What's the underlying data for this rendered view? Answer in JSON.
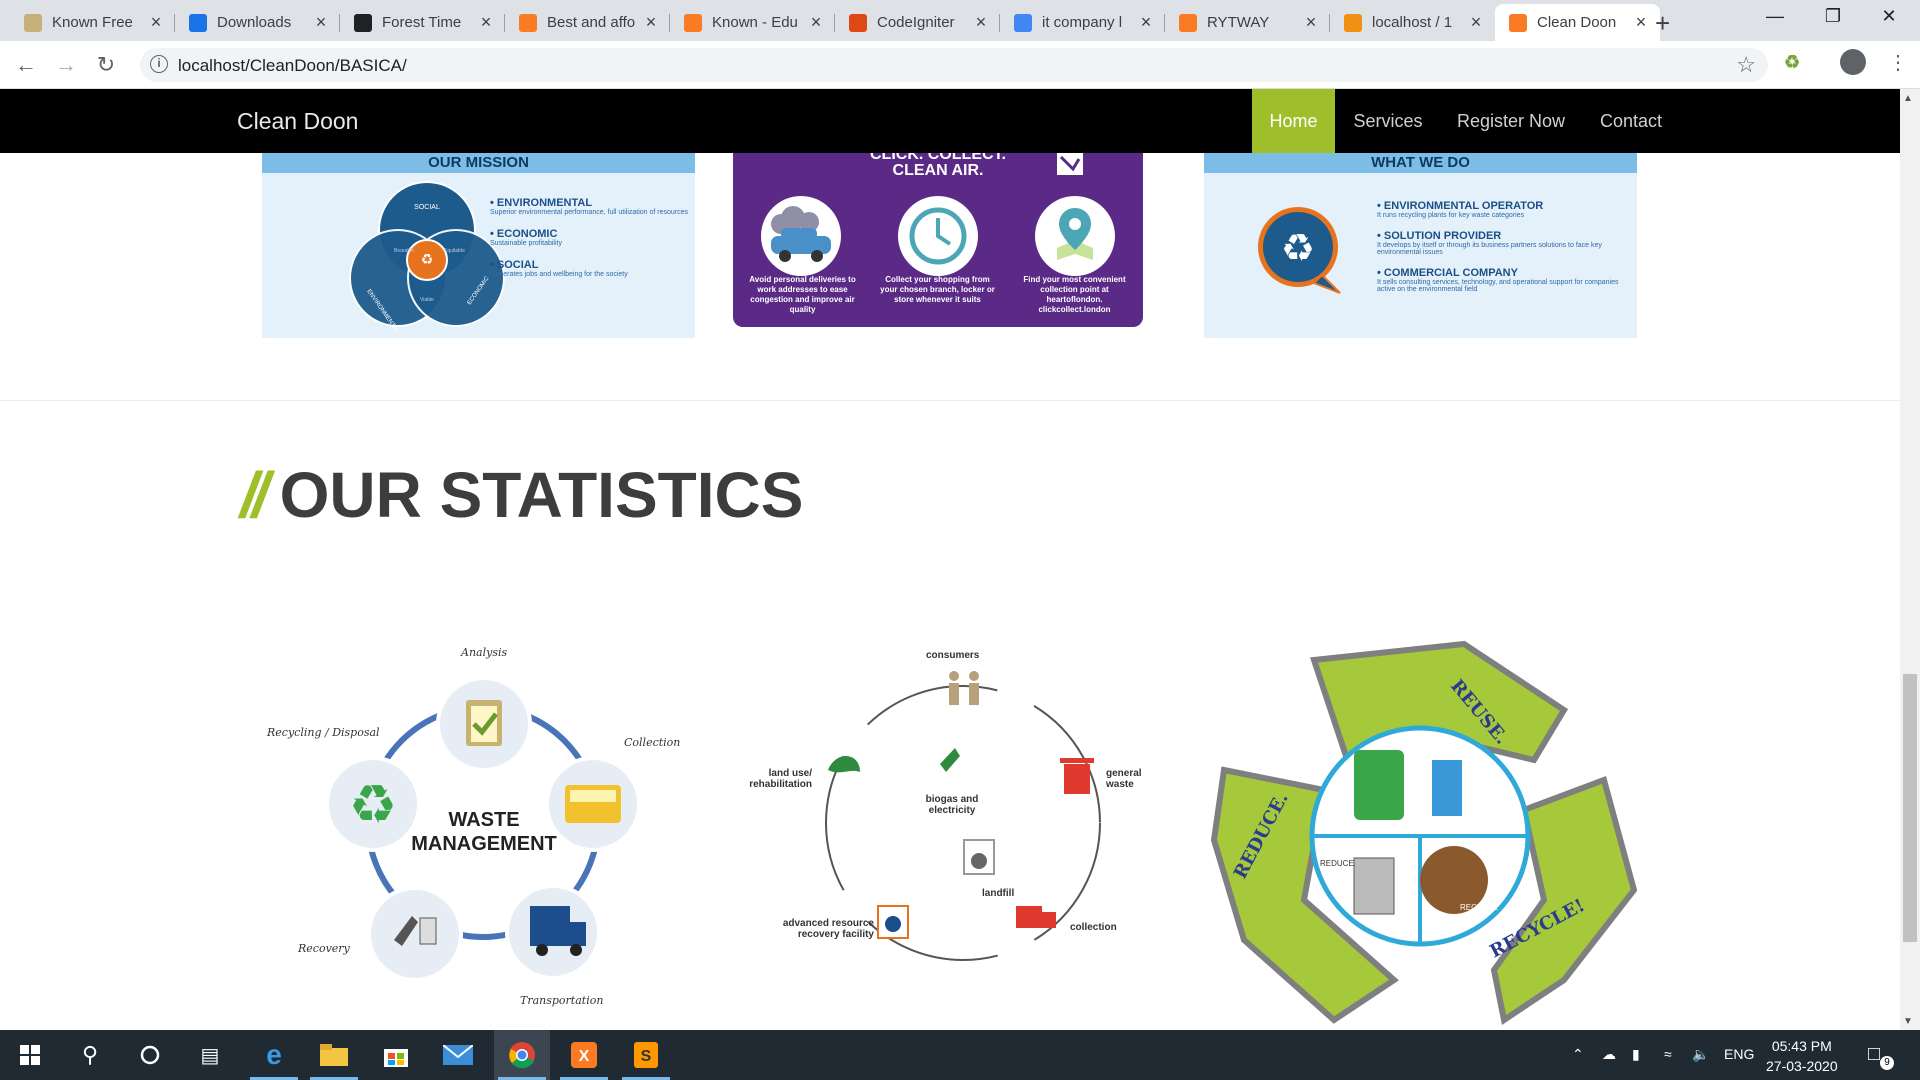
{
  "browser": {
    "tabs": [
      {
        "label": "Known Free",
        "favicon": "document-icon",
        "color": "#c6b07a"
      },
      {
        "label": "Downloads",
        "favicon": "download-icon",
        "color": "#1a73e8"
      },
      {
        "label": "Forest Time",
        "favicon": "edge-e-icon",
        "color": "#202124"
      },
      {
        "label": "Best and affo",
        "favicon": "xampp-icon",
        "color": "#fb7a24"
      },
      {
        "label": "Known - Edu",
        "favicon": "xampp-icon",
        "color": "#fb7a24"
      },
      {
        "label": "CodeIgniter",
        "favicon": "flame-icon",
        "color": "#dd4814"
      },
      {
        "label": "it company l",
        "favicon": "google-icon",
        "color": "#4285f4"
      },
      {
        "label": "RYTWAY",
        "favicon": "xampp-icon",
        "color": "#fb7a24"
      },
      {
        "label": "localhost / 1",
        "favicon": "phpmyadmin-icon",
        "color": "#f29111"
      },
      {
        "label": "Clean Doon",
        "favicon": "xampp-icon",
        "color": "#fb7a24"
      }
    ],
    "active_tab": 9,
    "url": "localhost/CleanDoon/BASICA/"
  },
  "site": {
    "brand": "Clean Doon",
    "nav": [
      "Home",
      "Services",
      "Register Now",
      "Contact"
    ],
    "accent": "#9ebf2a"
  },
  "mission": {
    "header": "OUR MISSION",
    "venn": [
      "SOCIAL",
      "ENVIRONMENTAL",
      "ECONOMIC",
      "Bearable",
      "Equitable",
      "Viable"
    ],
    "items": [
      {
        "title": "• ENVIRONMENTAL",
        "sub": "Superior environmental performance, full utilization of resources"
      },
      {
        "title": "• ECONOMIC",
        "sub": "Sustainable profitability"
      },
      {
        "title": "• SOCIAL",
        "sub": "Generates jobs and wellbeing for the society"
      }
    ]
  },
  "click": {
    "title1": "CLICK. COLLECT.",
    "title2": "CLEAN AIR.",
    "captions": [
      "Avoid personal deliveries to work addresses to ease congestion and improve air quality",
      "Collect your shopping from your chosen branch, locker or store whenever it suits",
      "Find your most convenient collection point at heartoflondon. clickcollect.london"
    ]
  },
  "whatwedo": {
    "header": "WHAT WE DO",
    "items": [
      {
        "title": "• ENVIRONMENTAL OPERATOR",
        "sub": "It runs recycling plants for key waste categories"
      },
      {
        "title": "• SOLUTION PROVIDER",
        "sub": "It develops by itself or through its business partners solutions to face key environmental issues"
      },
      {
        "title": "• COMMERCIAL COMPANY",
        "sub": "It sells consulting services, technology, and operational support for companies active on the environmental field"
      }
    ]
  },
  "statistics": {
    "title": "OUR STATISTICS",
    "waste_cycle": {
      "center1": "WASTE",
      "center2": "MANAGEMENT",
      "labels": [
        "Analysis",
        "Collection",
        "Transportation",
        "Recovery",
        "Recycling / Disposal"
      ]
    },
    "lifecycle": {
      "labels": [
        "consumers",
        "general waste",
        "collection",
        "landfill",
        "biogas and electricity",
        "advanced resource recovery facility",
        "land use/ rehabilitation"
      ]
    },
    "recycle": {
      "labels": [
        "REUSE.",
        "REDUCE.",
        "RECYCLE!",
        "REDUCE",
        "RECYCLE"
      ]
    }
  },
  "taskbar": {
    "tray_lang": "ENG",
    "time": "05:43 PM",
    "date": "27-03-2020",
    "notifications": "9"
  }
}
